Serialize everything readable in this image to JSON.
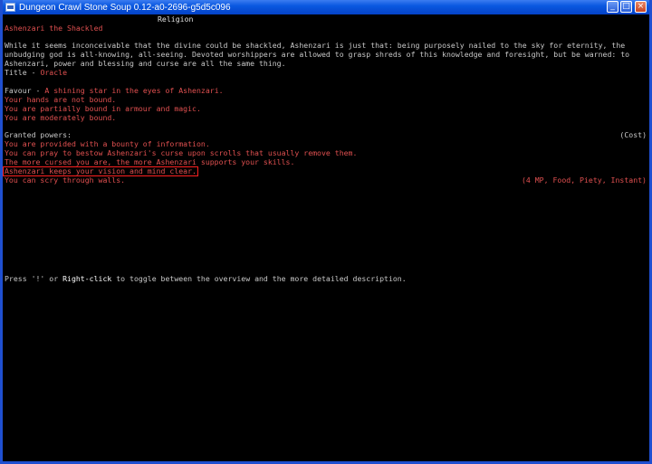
{
  "window": {
    "title": "Dungeon Crawl Stone Soup 0.12-a0-2696-g5d5c096",
    "min_label": "_",
    "max_label": "□",
    "close_label": "×"
  },
  "screen": {
    "header": "Religion",
    "god_name": "Ashenzari the Shackled",
    "description_1": "While it seems inconceivable that the divine could be shackled, Ashenzari is just that: being purposely nailed to the sky for eternity, the",
    "description_2": "unbudging god is all-knowing, all-seeing. Devoted worshippers are allowed to grasp shreds of this knowledge and foresight, but be warned: to",
    "description_3": "Ashenzari, power and blessing and curse are all the same thing.",
    "title_label": "Title - ",
    "title_value": "Oracle",
    "favour_label": "Favour - ",
    "favour_value": "A shining star in the eyes of Ashenzari.",
    "status_lines": [
      "Your hands are not bound.",
      "You are partially bound in armour and magic.",
      "You are moderately bound."
    ],
    "granted_label": "Granted powers:",
    "cost_label": "(Cost)",
    "powers": [
      "You are provided with a bounty of information.",
      "You can pray to bestow Ashenzari's curse upon scrolls that usually remove them.",
      "The more cursed you are, the more Ashenzari supports your skills.",
      "Ashenzari keeps your vision and mind clear.",
      "You can scry through walls."
    ],
    "scry_cost": "(4 MP, Food, Piety, Instant)",
    "footer_pre": "Press '!' or ",
    "footer_key": "Right-click",
    "footer_post": " to toggle between the overview and the more detailed description."
  },
  "colors": {
    "title_bar": "#0a58e0",
    "background": "#000000",
    "text": "#c8c8c8",
    "accent": "#e05050",
    "highlight": "#ff2020"
  }
}
